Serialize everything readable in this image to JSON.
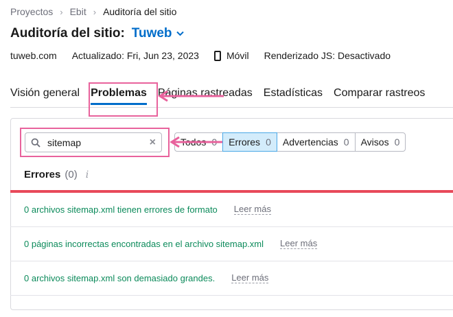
{
  "breadcrumb": {
    "items": [
      "Proyectos",
      "Ebit",
      "Auditoría del sitio"
    ]
  },
  "header": {
    "title": "Auditoría del sitio:",
    "project": "Tuweb"
  },
  "meta": {
    "domain": "tuweb.com",
    "updated": "Actualizado: Fri, Jun 23, 2023",
    "device": "Móvil",
    "js": "Renderizado JS: Desactivado"
  },
  "tabs": [
    "Visión general",
    "Problemas",
    "Páginas rastreadas",
    "Estadísticas",
    "Comparar rastreos"
  ],
  "search": {
    "value": "sitemap"
  },
  "filters": [
    {
      "label": "Todos",
      "count": "0"
    },
    {
      "label": "Errores",
      "count": "0"
    },
    {
      "label": "Advertencias",
      "count": "0"
    },
    {
      "label": "Avisos",
      "count": "0"
    }
  ],
  "section": {
    "title": "Errores",
    "count": "(0)",
    "info": "i"
  },
  "issues": [
    {
      "text": "0 archivos sitemap.xml tienen errores de formato",
      "more": "Leer más"
    },
    {
      "text": "0 páginas incorrectas encontradas en el archivo sitemap.xml",
      "more": "Leer más"
    },
    {
      "text": "0 archivos sitemap.xml son demasiado grandes.",
      "more": "Leer más"
    }
  ],
  "colors": {
    "accent": "#006dca",
    "highlight": "#e8629c",
    "error": "#e8495a",
    "issue_link": "#0b8a5a"
  }
}
